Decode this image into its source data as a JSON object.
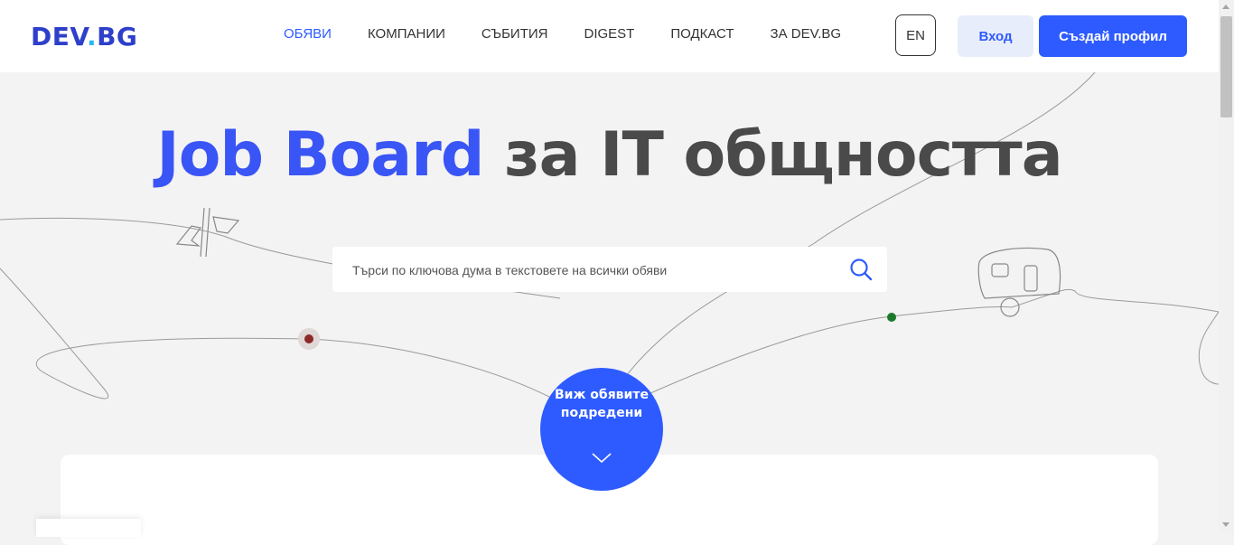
{
  "header": {
    "logo": {
      "main": "DEV",
      "dot": ".",
      "suffix": "BG"
    },
    "nav": [
      "ОБЯВИ",
      "КОМПАНИИ",
      "СЪБИТИЯ",
      "DIGEST",
      "ПОДКАСТ",
      "ЗА DEV.BG"
    ],
    "active_nav": "ОБЯВИ",
    "lang": "EN",
    "login": "Вход",
    "register": "Създай профил"
  },
  "hero": {
    "title_highlight": "Job Board",
    "title_rest": " за IT общността",
    "search_placeholder": "Търси по ключова дума в текстовете на всички обяви",
    "cta": "Виж обявите подредени"
  },
  "colors": {
    "brand": "#2e5bff",
    "title_dark": "#4a4a4a",
    "title_blue": "#3a55f5",
    "background": "#f3f3f3"
  },
  "icons": [
    "search-icon",
    "chevron-down-icon",
    "pointer-sign-icon",
    "caravan-icon"
  ]
}
